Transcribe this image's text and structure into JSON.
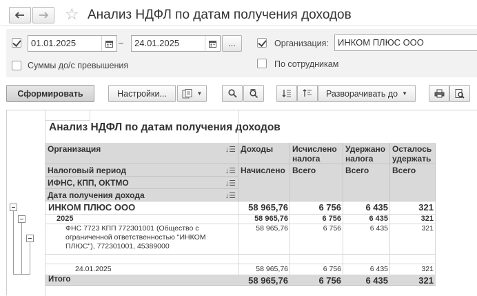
{
  "window": {
    "title": "Анализ НДФЛ по датам получения доходов"
  },
  "filters": {
    "period_from": "01.01.2025",
    "period_sep": "–",
    "period_to": "24.01.2025",
    "more_label": "...",
    "org_label": "Организация:",
    "org_value": "ИНКОМ ПЛЮС ООО",
    "sums_label": "Суммы до/с превышения",
    "by_employee_label": "По сотрудникам"
  },
  "toolbar": {
    "generate": "Сформировать",
    "settings": "Настройки...",
    "expand": "Разворачивать до"
  },
  "report": {
    "heading": "Анализ НДФЛ по датам получения доходов",
    "dim_headers": [
      "Организация",
      "Налоговый период",
      "ИФНС, КПП, ОКТМО",
      "Дата получения дохода"
    ],
    "col_headers": [
      {
        "top": "Доходы",
        "sub": "Начислено"
      },
      {
        "top": "Исчислено налога",
        "sub": "Всего"
      },
      {
        "top": "Удержано налога",
        "sub": "Всего"
      },
      {
        "top": "Осталось удержать",
        "sub": "Всего"
      }
    ],
    "rows": [
      {
        "label": "ИНКОМ ПЛЮС ООО",
        "v1": "58 965,76",
        "v2": "6 756",
        "v3": "6 435",
        "v4": "321"
      },
      {
        "label": "2025",
        "v1": "58 965,76",
        "v2": "6 756",
        "v3": "6 435",
        "v4": "321"
      },
      {
        "label": "ФНС 7723 КПП 772301001 (Общество с ограниченной ответственностью \"ИНКОМ ПЛЮС\"), 772301001, 45389000",
        "v1": "58 965,76",
        "v2": "6 756",
        "v3": "6 435",
        "v4": "321"
      },
      {
        "label": "24.01.2025",
        "v1": "58 965,76",
        "v2": "6 756",
        "v3": "6 435",
        "v4": "321"
      }
    ],
    "total": {
      "label": "Итого",
      "v1": "58 965,76",
      "v2": "6 756",
      "v3": "6 435",
      "v4": "321"
    }
  }
}
